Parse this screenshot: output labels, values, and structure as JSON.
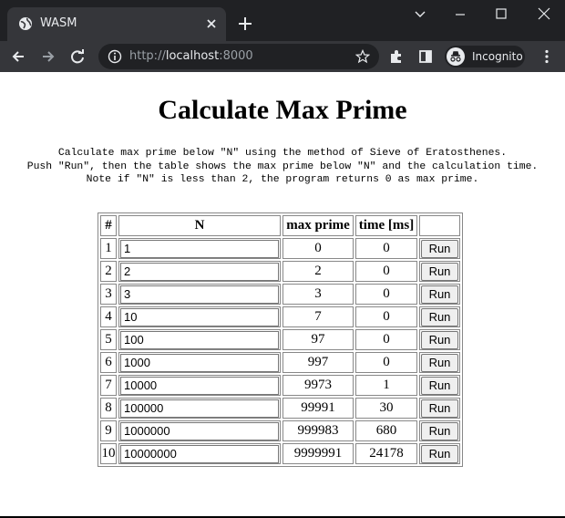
{
  "browser": {
    "tab_title": "WASM",
    "url_scheme": "http://",
    "url_host": "localhost",
    "url_port": ":8000",
    "profile_label": "Incognito"
  },
  "page": {
    "title": "Calculate Max Prime",
    "description": "Calculate max prime below \"N\" using the method of Sieve of Eratosthenes.\nPush \"Run\", then the table shows the max prime below \"N\" and the calculation time.\nNote if \"N\" is less than 2, the program returns 0 as max prime."
  },
  "table": {
    "headers": {
      "index": "#",
      "n": "N",
      "max_prime": "max prime",
      "time": "time [ms]",
      "action": ""
    },
    "run_label": "Run",
    "rows": [
      {
        "index": "1",
        "n": "1",
        "max_prime": "0",
        "time": "0"
      },
      {
        "index": "2",
        "n": "2",
        "max_prime": "2",
        "time": "0"
      },
      {
        "index": "3",
        "n": "3",
        "max_prime": "3",
        "time": "0"
      },
      {
        "index": "4",
        "n": "10",
        "max_prime": "7",
        "time": "0"
      },
      {
        "index": "5",
        "n": "100",
        "max_prime": "97",
        "time": "0"
      },
      {
        "index": "6",
        "n": "1000",
        "max_prime": "997",
        "time": "0"
      },
      {
        "index": "7",
        "n": "10000",
        "max_prime": "9973",
        "time": "1"
      },
      {
        "index": "8",
        "n": "100000",
        "max_prime": "99991",
        "time": "30"
      },
      {
        "index": "9",
        "n": "1000000",
        "max_prime": "999983",
        "time": "680"
      },
      {
        "index": "10",
        "n": "10000000",
        "max_prime": "9999991",
        "time": "24178"
      }
    ]
  },
  "icons": {
    "tab_favicon": "globe-icon",
    "tab_close": "close-icon",
    "new_tab": "plus-icon",
    "back": "arrow-left-icon",
    "forward": "arrow-right-icon",
    "reload": "reload-icon",
    "site_info": "info-icon",
    "bookmark": "star-icon",
    "extensions": "puzzle-icon",
    "side_panel": "side-panel-icon",
    "incognito": "incognito-icon",
    "menu": "kebab-menu-icon"
  },
  "colors": {
    "tabstrip": "#202124",
    "toolbar": "#35363a",
    "chrome_text": "#e8eaed",
    "url_muted": "#9aa0a6"
  }
}
